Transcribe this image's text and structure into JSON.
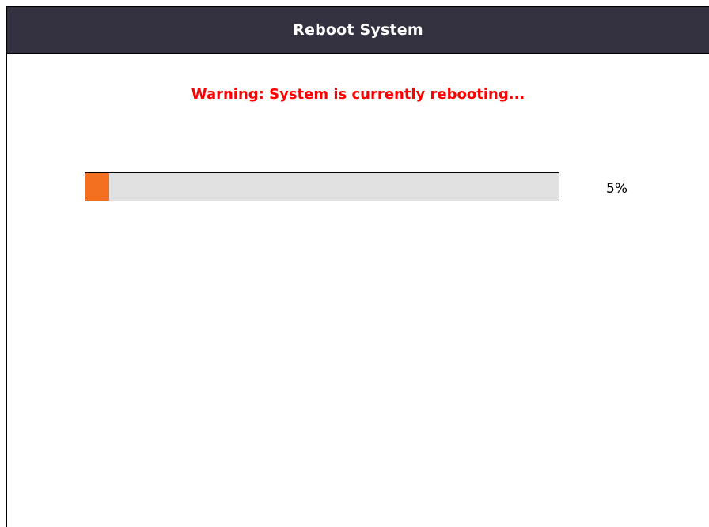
{
  "dialog": {
    "title": "Reboot System"
  },
  "status": {
    "warning_text": "Warning: System is currently rebooting...",
    "warning_color": "#ff0000"
  },
  "progress": {
    "value": 0.05,
    "percent_label": "5%",
    "fill_color": "#f37021",
    "track_color": "#e1e1e1"
  },
  "theme": {
    "header_bg": "#343241",
    "header_text": "#ffffff"
  }
}
